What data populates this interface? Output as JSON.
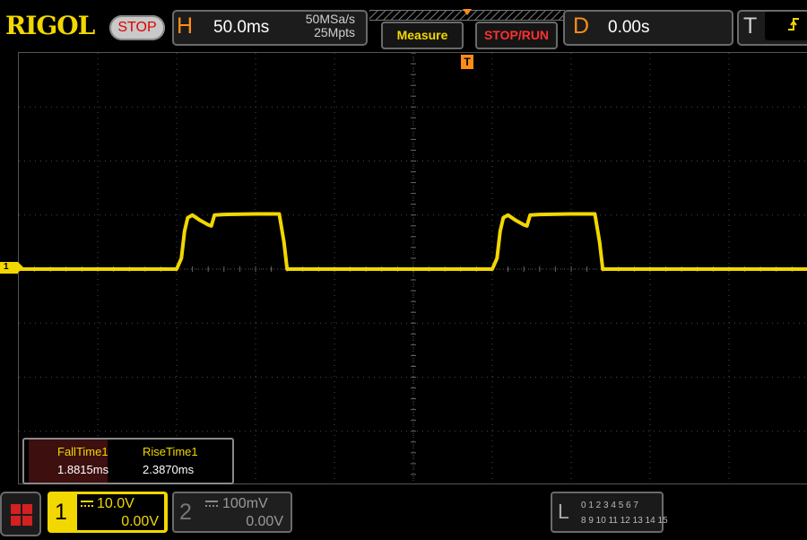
{
  "brand": {
    "logo": "RIGOL",
    "run_status": "STOP"
  },
  "horizontal": {
    "letter": "H",
    "timebase": "50.0ms",
    "sample_rate": "50MSa/s",
    "memory_depth": "25Mpts"
  },
  "buttons": {
    "measure": "Measure",
    "stop_run": "STOP/RUN"
  },
  "delay": {
    "letter": "D",
    "value": "0.00s"
  },
  "trigger": {
    "letter": "T",
    "edge_icon": "rising-edge-icon",
    "position_marker": "T"
  },
  "channel_marker": "1",
  "measurements": [
    {
      "name": "FallTime1",
      "value": "1.8815ms"
    },
    {
      "name": "RiseTime1",
      "value": "2.3870ms"
    }
  ],
  "channels": [
    {
      "number": "1",
      "scale": "10.0V",
      "offset": "0.00V",
      "active": true
    },
    {
      "number": "2",
      "scale": "100mV",
      "offset": "0.00V",
      "active": false
    }
  ],
  "logic_analyzer": {
    "letter": "L",
    "row1": "0 1 2 3   4 5 6 7",
    "row2": "8 9 10 11 12 13 14 15"
  },
  "colors": {
    "ch1": "#f2d700",
    "accent": "#ff8c1a",
    "stop": "#e00000"
  },
  "chart_data": {
    "type": "line",
    "title": "",
    "xlabel": "",
    "ylabel": "",
    "grid": true,
    "x_unit": "ms",
    "y_unit": "V",
    "xlim": [
      -250,
      250
    ],
    "ylim": [
      -40,
      40
    ],
    "series": [
      {
        "x": [
          -250,
          -150,
          -147,
          -145,
          -143,
          -140,
          -135,
          -130,
          -128,
          -126,
          -120,
          -100,
          -85,
          -82,
          -80,
          -77,
          -70,
          -50,
          -30,
          50,
          53,
          55,
          57,
          60,
          65,
          70,
          72,
          74,
          80,
          100,
          115,
          118,
          120,
          123,
          130,
          150,
          170,
          250
        ],
        "y": [
          0,
          0,
          2,
          7,
          9.5,
          10,
          9,
          8.2,
          8,
          10,
          10.1,
          10.2,
          10.2,
          5,
          0,
          0,
          0,
          0,
          0,
          0,
          2,
          7,
          9.5,
          10,
          9,
          8.2,
          8,
          10,
          10.1,
          10.2,
          10.2,
          5,
          0,
          0,
          0,
          0,
          0,
          0
        ]
      }
    ]
  }
}
